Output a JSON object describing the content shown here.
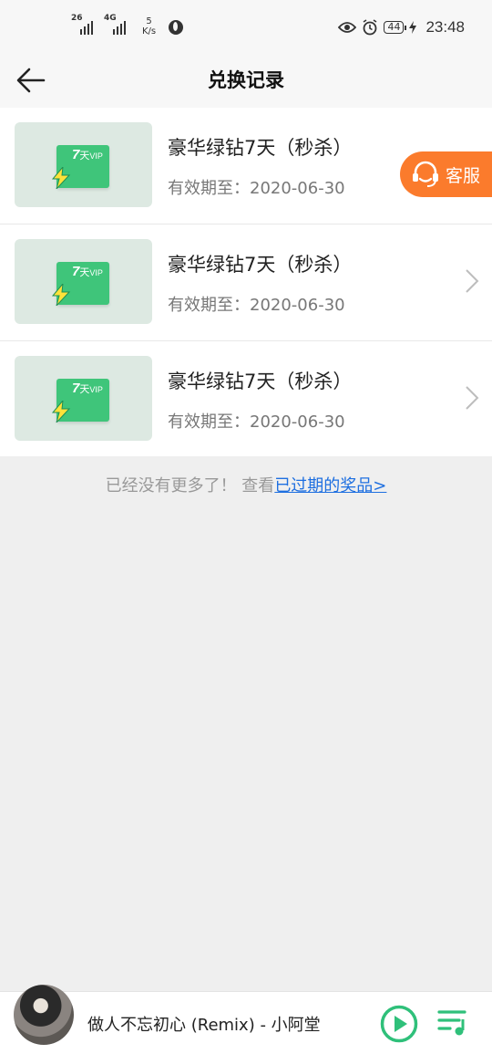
{
  "status_bar": {
    "net1": "26",
    "net2": "4G",
    "speed_value": "5",
    "speed_unit": "K/s",
    "battery": "44",
    "time": "23:48"
  },
  "header": {
    "title": "兑换记录"
  },
  "items": [
    {
      "thumb_days": "7",
      "thumb_day_unit": "天",
      "thumb_vip": "VIP",
      "title": "豪华绿钻7天（秒杀）",
      "expiry": "有效期至：2020-06-30"
    },
    {
      "thumb_days": "7",
      "thumb_day_unit": "天",
      "thumb_vip": "VIP",
      "title": "豪华绿钻7天（秒杀）",
      "expiry": "有效期至：2020-06-30"
    },
    {
      "thumb_days": "7",
      "thumb_day_unit": "天",
      "thumb_vip": "VIP",
      "title": "豪华绿钻7天（秒杀）",
      "expiry": "有效期至：2020-06-30"
    }
  ],
  "service": {
    "label": "客服"
  },
  "footer": {
    "no_more": "已经没有更多了！  查看",
    "expired_link": "已过期的奖品>"
  },
  "player": {
    "song": "做人不忘初心 (Remix) - 小阿堂"
  },
  "colors": {
    "accent_green": "#3fc57a",
    "service_orange": "#fb7b2c",
    "link_blue": "#1e6fe0",
    "player_green": "#2fc07a"
  }
}
